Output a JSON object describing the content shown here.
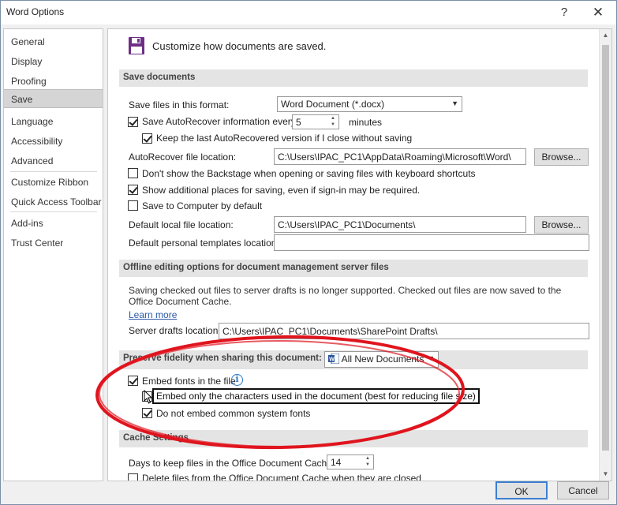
{
  "window": {
    "title": "Word Options",
    "help_glyph": "?",
    "close_glyph": "✕"
  },
  "nav": {
    "items": [
      {
        "label": "General"
      },
      {
        "label": "Display"
      },
      {
        "label": "Proofing"
      },
      {
        "label": "Save",
        "active": true
      },
      {
        "label": "Language"
      },
      {
        "label": "Accessibility"
      },
      {
        "label": "Advanced"
      },
      {
        "label": "Customize Ribbon"
      },
      {
        "label": "Quick Access Toolbar"
      },
      {
        "label": "Add-ins"
      },
      {
        "label": "Trust Center"
      }
    ]
  },
  "header": {
    "text": "Customize how documents are saved.",
    "icon": "save-floppy-icon"
  },
  "save_documents": {
    "section_title": "Save documents",
    "format_label": "Save files in this format:",
    "format_value": "Word Document (*.docx)",
    "autorecover_label": "Save AutoRecover information every",
    "autorecover_checked": true,
    "autorecover_minutes": "5",
    "minutes_label": "minutes",
    "keep_last_label": "Keep the last AutoRecovered version if I close without saving",
    "keep_last_checked": true,
    "ar_location_label": "AutoRecover file location:",
    "ar_location_value": "C:\\Users\\IPAC_PC1\\AppData\\Roaming\\Microsoft\\Word\\",
    "browse_label": "Browse...",
    "backstage_label": "Don't show the Backstage when opening or saving files with keyboard shortcuts",
    "backstage_checked": false,
    "additional_places_label": "Show additional places for saving, even if sign-in may be required.",
    "additional_places_checked": true,
    "save_to_computer_label": "Save to Computer by default",
    "save_to_computer_checked": false,
    "default_local_label": "Default local file location:",
    "default_local_value": "C:\\Users\\IPAC_PC1\\Documents\\",
    "browse2_label": "Browse...",
    "personal_templates_label": "Default personal templates location:",
    "personal_templates_value": ""
  },
  "offline": {
    "section_title": "Offline editing options for document management server files",
    "note": "Saving checked out files to server drafts is no longer supported. Checked out files are now saved to the Office Document Cache.",
    "learn_more": "Learn more",
    "drafts_label": "Server drafts location:",
    "drafts_value": "C:\\Users\\IPAC_PC1\\Documents\\SharePoint Drafts\\"
  },
  "fidelity": {
    "section_title": "Preserve fidelity when sharing this document:",
    "doc_value": "All New Documents",
    "embed_fonts_label": "Embed fonts in the file",
    "embed_fonts_checked": true,
    "embed_only_label": "Embed only the characters used in the document (best for reducing file size)",
    "embed_only_checked": false,
    "no_common_label": "Do not embed common system fonts",
    "no_common_checked": true
  },
  "cache": {
    "section_title": "Cache Settings",
    "days_label": "Days to keep files in the Office Document Cache:",
    "days_value": "14",
    "delete_label": "Delete files from the Office Document Cache when they are closed"
  },
  "footer": {
    "ok_label": "OK",
    "cancel_label": "Cancel"
  },
  "colors": {
    "annotation": "#e0141e",
    "link": "#2a58a8",
    "ok_border": "#3c7fd0"
  }
}
